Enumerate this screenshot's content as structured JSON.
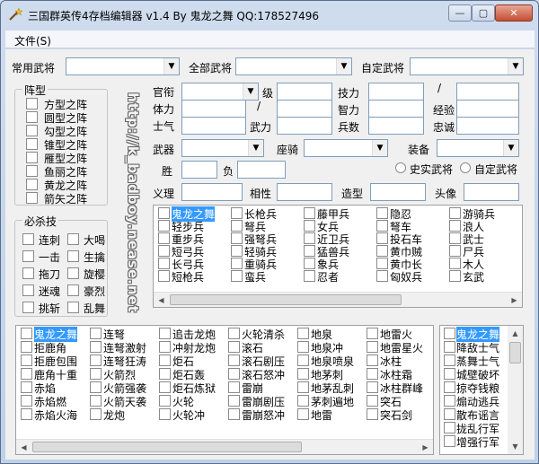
{
  "window": {
    "title": "三国群英传4存档编辑器 v1.4 By 鬼龙之舞 QQ:178527496",
    "min": "—",
    "max": "▢",
    "close": "✕"
  },
  "menu": {
    "file": "文件(S)"
  },
  "top": {
    "common_label": "常用武将",
    "all_label": "全部武将",
    "custom_label": "自定武将"
  },
  "formation": {
    "title": "阵型",
    "items": [
      "方型之阵",
      "圆型之阵",
      "勾型之阵",
      "锥型之阵",
      "雁型之阵",
      "鱼丽之阵",
      "黄龙之阵",
      "箭矢之阵"
    ]
  },
  "skills": {
    "title": "必杀技",
    "rows": [
      [
        "连刺",
        "大喝"
      ],
      [
        "一击",
        "生擒"
      ],
      [
        "拖刀",
        "旋樱"
      ],
      [
        "迷魂",
        "豪烈"
      ],
      [
        "挑斩",
        "乱舞"
      ]
    ]
  },
  "watermark": "http://k_badboy.nease.net",
  "stats": {
    "official": "官衔",
    "level": "级",
    "power": "技力",
    "slash": "/",
    "hp": "体力",
    "int": "智力",
    "exp": "经验",
    "morale": "士气",
    "str": "武力",
    "troops": "兵数",
    "loyalty": "忠诚",
    "weapon": "武器",
    "mount": "座骑",
    "equip": "装备",
    "win": "胜",
    "lose": "负",
    "history_radio": "史实武将",
    "custom_radio": "自定武将",
    "righteous": "义理",
    "compat": "相性",
    "model": "造型",
    "portrait": "头像"
  },
  "units_list": {
    "items": [
      "鬼龙之舞",
      "长枪兵",
      "藤甲兵",
      "隐忍",
      "游骑兵",
      "轻步兵",
      "弩兵",
      "女兵",
      "弩车",
      "浪人",
      "重步兵",
      "强弩兵",
      "近卫兵",
      "投石车",
      "武士",
      "短弓兵",
      "轻骑兵",
      "猛兽兵",
      "黄巾贼",
      "尸兵",
      "长弓兵",
      "重骑兵",
      "象兵",
      "黄巾长",
      "木人",
      "短枪兵",
      "蛮兵",
      "忍者",
      "匈奴兵",
      "玄武"
    ]
  },
  "tactics_list": {
    "items": [
      "鬼龙之舞",
      "连弩",
      "追击龙炮",
      "火轮清杀",
      "地泉",
      "地雷火",
      "拒鹿角",
      "连弩激射",
      "冲射龙炮",
      "滚石",
      "地泉冲",
      "地雷星火",
      "拒鹿包围",
      "连弩狂涛",
      "炬石",
      "滚石剧压",
      "地泉喷泉",
      "冰柱",
      "鹿角十重",
      "火箭烈",
      "炬石轰",
      "滚石怒冲",
      "地茅刺",
      "冰柱霜",
      "赤焰",
      "火箭强袭",
      "炬石炼狱",
      "雷崩",
      "地茅乱刺",
      "冰柱群峰",
      "赤焰燃",
      "火箭天袭",
      "火轮",
      "雷崩剧压",
      "茅刺遍地",
      "突石",
      "赤焰火海",
      "龙炮",
      "火轮冲",
      "雷崩怒冲",
      "地雷",
      "突石剑"
    ]
  },
  "small_list": {
    "items": [
      "鬼龙之舞",
      "降敌士气",
      "蒸舞士气",
      "城壁破坏",
      "掠夺钱粮",
      "煽动逃兵",
      "散布谣言",
      "拢乱行军",
      "增强行军"
    ]
  },
  "colors": {
    "selection": "#3399ff",
    "frame": "#cfdcee",
    "client": "#f0f0f0",
    "close": "#c44d33"
  }
}
